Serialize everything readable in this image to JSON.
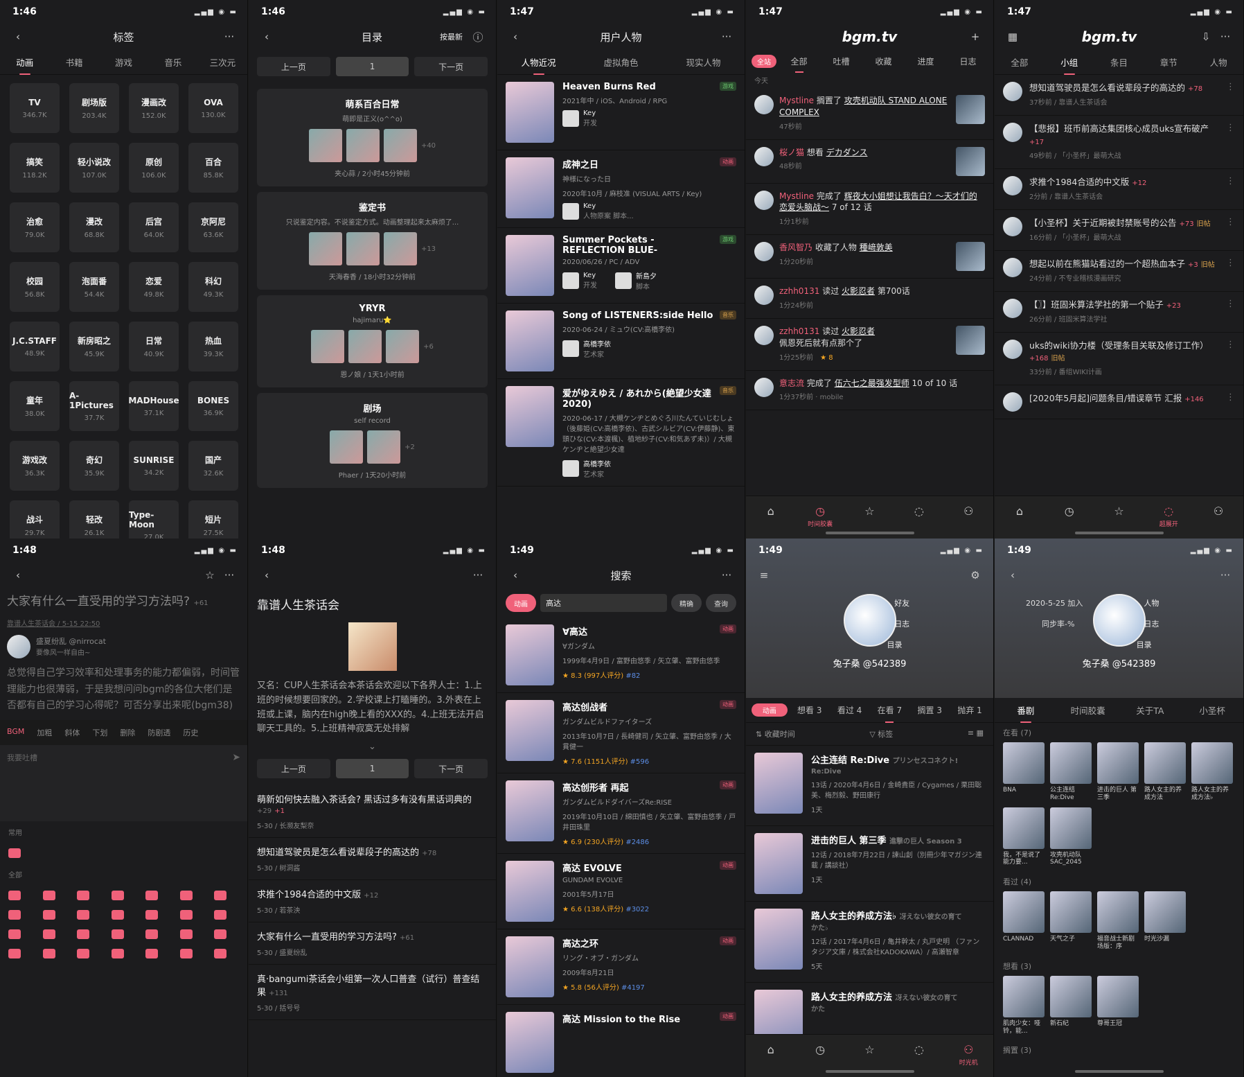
{
  "phones": {
    "p1": {
      "time": "1:46",
      "title": "标签",
      "tabs": [
        "动画",
        "书籍",
        "游戏",
        "音乐",
        "三次元"
      ],
      "tags": [
        {
          "n": "TV",
          "c": "346.7K"
        },
        {
          "n": "剧场版",
          "c": "203.4K"
        },
        {
          "n": "漫画改",
          "c": "152.0K"
        },
        {
          "n": "OVA",
          "c": "130.0K"
        },
        {
          "n": "搞笑",
          "c": "118.2K"
        },
        {
          "n": "轻小说改",
          "c": "107.0K"
        },
        {
          "n": "原创",
          "c": "106.0K"
        },
        {
          "n": "百合",
          "c": "85.8K"
        },
        {
          "n": "治愈",
          "c": "79.0K"
        },
        {
          "n": "漫改",
          "c": "68.8K"
        },
        {
          "n": "后宫",
          "c": "64.0K"
        },
        {
          "n": "京阿尼",
          "c": "63.6K"
        },
        {
          "n": "校园",
          "c": "56.8K"
        },
        {
          "n": "泡面番",
          "c": "54.4K"
        },
        {
          "n": "恋爱",
          "c": "49.8K"
        },
        {
          "n": "科幻",
          "c": "49.3K"
        },
        {
          "n": "J.C.STAFF",
          "c": "48.9K"
        },
        {
          "n": "新房昭之",
          "c": "45.9K"
        },
        {
          "n": "日常",
          "c": "40.9K"
        },
        {
          "n": "热血",
          "c": "39.3K"
        },
        {
          "n": "童年",
          "c": "38.0K"
        },
        {
          "n": "A-1Pictures",
          "c": "37.7K"
        },
        {
          "n": "MADHouse",
          "c": "37.1K"
        },
        {
          "n": "BONES",
          "c": "36.9K"
        },
        {
          "n": "游戏改",
          "c": "36.3K"
        },
        {
          "n": "奇幻",
          "c": "35.9K"
        },
        {
          "n": "SUNRISE",
          "c": "34.2K"
        },
        {
          "n": "国产",
          "c": "32.6K"
        },
        {
          "n": "战斗",
          "c": "29.7K"
        },
        {
          "n": "轻改",
          "c": "26.1K"
        },
        {
          "n": "Type-Moon",
          "c": "27.0K"
        },
        {
          "n": "短片",
          "c": "27.5K"
        }
      ]
    },
    "p2": {
      "time": "1:46",
      "title": "目录",
      "sort": "按最新",
      "prev": "上一页",
      "page": "1",
      "next": "下一页",
      "cards": [
        {
          "t": "萌系百合日常",
          "s": "萌即是正义(o^^o)",
          "more": "+40",
          "f": "夹心蒜 / 2小时45分钟前"
        },
        {
          "t": "鉴定书",
          "s": "只说鉴定内容。不说鉴定方式。动画整理起来太麻烦了...",
          "more": "+13",
          "f": "天海春香 / 18小时32分钟前"
        },
        {
          "t": "YRYR",
          "s": "hajimaru⭐",
          "more": "+6",
          "f": "恩ノ娘 / 1天1小时前"
        },
        {
          "t": "剧场",
          "s": "self record",
          "more": "+2",
          "f": "Phaer / 1天20小时前"
        }
      ]
    },
    "p3": {
      "time": "1:47",
      "title": "用户人物",
      "tabs": [
        "人物近况",
        "虚拟角色",
        "现实人物"
      ],
      "items": [
        {
          "t": "Heaven Burns Red",
          "d": "2021年中 / iOS、Android / RPG",
          "b": "游戏",
          "bc": "g",
          "cast": [
            {
              "n": "Key",
              "r": "开发"
            }
          ]
        },
        {
          "t": "成神之日",
          "d": "神様になった日",
          "d2": "2020年10月 / 麻枝准 (VISUAL ARTS / Key)",
          "b": "动画",
          "bc": "r",
          "cast": [
            {
              "n": "Key",
              "r": "人物原案 脚本..."
            }
          ]
        },
        {
          "t": "Summer Pockets -REFLECTION BLUE-",
          "d": "2020/06/26 / PC / ADV",
          "b": "游戏",
          "bc": "g",
          "cast": [
            {
              "n": "Key",
              "r": "开发"
            },
            {
              "n": "新島夕",
              "r": "脚本"
            }
          ]
        },
        {
          "t": "Song of LISTENERS:side Hello",
          "d": "2020-06-24 / ミュウ(CV:高橋李依)",
          "b": "音乐",
          "bc": "o",
          "cast": [
            {
              "n": "高橋李依",
              "r": "艺术家"
            }
          ]
        },
        {
          "t": "爱がゆえゆえ / あれから(絶望少女達2020)",
          "d": "2020-06-17 / 大槻ケンヂとめぐろ川たんていじむしょ（後藤姫(CV:高橋李依)、古武シルビア(CV:伊藤静)、東頭ひな(CV:本渡楓)、植地紗子(CV:和気あず未)）/ 大槻ケンヂと絶望少女達",
          "b": "音乐",
          "bc": "o",
          "cast": [
            {
              "n": "高橋李依",
              "r": "艺术家"
            }
          ]
        }
      ]
    },
    "p4": {
      "time": "1:47",
      "logo": "bgm.tv",
      "tabs": [
        "全站",
        "全部",
        "吐槽",
        "收藏",
        "进度",
        "日志"
      ],
      "today": "今天",
      "items": [
        {
          "u": "Mystline",
          "a": "搁置了",
          "o": "攻壳机动队 STAND ALONE COMPLEX",
          "m": "47秒前"
        },
        {
          "u": "桜ノ猫",
          "a": "想看",
          "o": "デカダンス",
          "m": "48秒前"
        },
        {
          "u": "Mystline",
          "a": "完成了",
          "o": "辉夜大小姐想让我告白？～天才们的恋爱头脑战～",
          "x": " 7 of 12 话",
          "m": "1分1秒前"
        },
        {
          "u": "香风智乃",
          "a": "收藏了人物",
          "o": "種﨑敦美",
          "m": "1分20秒前"
        },
        {
          "u": "zzhh0131",
          "a": "读过",
          "o": "火影忍者",
          "x": " 第700话",
          "m": "1分24秒前"
        },
        {
          "u": "zzhh0131",
          "a": "读过",
          "o": "火影忍者",
          "x": "",
          "c": "佩恩死后就有点那个了",
          "m": "1分25秒前",
          "r": "★ 8"
        },
        {
          "u": "意志流",
          "a": "完成了",
          "o": "伍六七之最强发型师",
          "x": " 10 of 10 话",
          "m": "1分37秒前 · mobile"
        }
      ],
      "nav": [
        "⌂",
        "时间胶囊",
        "☆",
        "💬",
        "👤"
      ]
    },
    "p5": {
      "time": "1:47",
      "logo": "bgm.tv",
      "tabs": [
        "全部",
        "小组",
        "条目",
        "章节",
        "人物"
      ],
      "sub": "全部",
      "items": [
        {
          "t": "想知道驾驶员是怎么看说辈段子的高达的",
          "n": "+78",
          "m": "37秒前 / 靠谱人生茶话会"
        },
        {
          "t": "【悲报】班币前高达集团核心成员uks宣布破产",
          "n": "+17",
          "m": "49秒前 / 「小圣杯」最萌大战"
        },
        {
          "t": "求推个1984合适的中文版",
          "n": "+12",
          "m": "2分前 / 靠谱人生茶话会"
        },
        {
          "t": "【小圣杯】关于近期被封禁账号的公告",
          "n": "+73",
          "o": "旧帖",
          "m": "16分前 / 「小圣杯」最萌大战"
        },
        {
          "t": "想起以前在熊猫站看过的一个超热血本子",
          "n": "+3",
          "o": "旧帖",
          "m": "24分前 / 不专业稽核漫画研究"
        },
        {
          "t": "【〗】班固米算法学社的第一个贴子",
          "n": "+23",
          "m": "26分前 / 班固米算法学社"
        },
        {
          "t": "uks的wiki协力楼（受理条目关联及修订工作）",
          "n": "+168",
          "o": "旧帖",
          "m": "33分前 / 番组WIKI计画"
        },
        {
          "t": "[2020年5月起]问题条目/错误章节 汇报",
          "n": "+146",
          "m": ""
        }
      ],
      "nav_label": "超展开"
    },
    "p6": {
      "time": "1:48",
      "title": "大家有什么一直受用的学习方法吗?",
      "count": "+61",
      "group": "靠谱人生茶话会 / 5-15 22:50",
      "user": "盛夏纷乱",
      "handle": "@nirrocat",
      "sign": "要像风一样自由~",
      "body": "总觉得自己学习效率和处理事务的能力都偏弱，时间管理能力也很薄弱，于是我想问问bgm的各位大佬们是否都有自己的学习心得呢？可否分享出来呢(bgm38)",
      "tools": [
        "BGM",
        "加粗",
        "斜体",
        "下划",
        "删除",
        "防剧透",
        "历史"
      ],
      "placeholder": "我要吐槽",
      "common": "常用",
      "all": "全部"
    },
    "p7": {
      "time": "1:48",
      "title": "靠谱人生茶话会",
      "desc": "又名：CUP人生茶话会本茶话会欢迎以下各界人士：1.上班的时候想要回家的。2.学校课上打瞌睡的。3.外表在上班或上课，脑内在high晚上看的XXX的。4.上班无法开启聊天工具的。5.上班精神寂寞无处排解",
      "prev": "上一页",
      "page": "1",
      "next": "下一页",
      "topics": [
        {
          "t": "萌新如何快去融入茶话会? 黑话过多有没有黑话词典的",
          "n": "+29",
          "x": "+1",
          "m": "5-30 / 长濒友梨奈"
        },
        {
          "t": "想知道驾驶员是怎么看说辈段子的高达的",
          "n": "+78",
          "m": "5-30 / 树洞酱"
        },
        {
          "t": "求推个1984合适的中文版",
          "n": "+12",
          "m": "5-30 / 若茶泱"
        },
        {
          "t": "大家有什么一直受用的学习方法吗?",
          "n": "+61",
          "m": "5-30 / 盛夏纷乱"
        },
        {
          "t": "真·bangumi茶话会小组第一次人口普查（试行）普查结果",
          "n": "+131",
          "m": "5-30 / 括号号"
        }
      ]
    },
    "p8": {
      "time": "1:49",
      "title": "搜索",
      "type": "动画",
      "query": "高达",
      "mode": "精确",
      "go": "查询",
      "items": [
        {
          "t": "∀高达",
          "j": "∀ガンダム",
          "d": "1999年4月9日 / 富野由悠季 / 矢立肇、富野由悠季",
          "s": "★ 8.3 (997人评分)",
          "r": "#82"
        },
        {
          "t": "高达创战者",
          "j": "ガンダムビルドファイターズ",
          "d": "2013年10月7日 / 長崎健司 / 矢立肇、富野由悠季 / 大貫健一",
          "s": "★ 7.6 (1151人评分)",
          "r": "#596"
        },
        {
          "t": "高达创形者 再起",
          "j": "ガンダムビルドダイバーズRe:RISE",
          "d": "2019年10月10日 / 綿田慎也 / 矢立肇、富野由悠季 / 戸井田珠里",
          "s": "★ 6.9 (230人评分)",
          "r": "#2486"
        },
        {
          "t": "高达 EVOLVE",
          "j": "GUNDAM EVOLVE",
          "d": "2001年5月17日",
          "s": "★ 6.6 (138人评分)",
          "r": "#3022"
        },
        {
          "t": "高达之环",
          "j": "リング・オブ・ガンダム",
          "d": "2009年8月21日",
          "s": "★ 5.8 (56人评分)",
          "r": "#4197"
        },
        {
          "t": "高达 Mission to the Rise",
          "j": "",
          "d": "",
          "s": "",
          "r": ""
        }
      ],
      "badge": "动画"
    },
    "p9": {
      "time": "1:49",
      "name": "兔子桑 @542389",
      "links": [
        "好友",
        "日志",
        "目录"
      ],
      "tabs": [
        {
          "l": "动画",
          "p": true
        },
        {
          "l": "想看 3"
        },
        {
          "l": "看过 4"
        },
        {
          "l": "在看 7",
          "on": true
        },
        {
          "l": "搁置 3"
        },
        {
          "l": "抛弃 1"
        }
      ],
      "sort": "收藏时间",
      "tag": "标签",
      "items": [
        {
          "t": "公主连结 Re:Dive",
          "j": "プリンセスコネクト! Re:Dive",
          "d": "13话 / 2020年4月6日 / 金崎貴臣 / Cygames / 栗田聡美、梅烈毅、野田康行",
          "m": "1天"
        },
        {
          "t": "进击的巨人 第三季",
          "j": "進撃の巨人 Season 3",
          "d": "12话 / 2018年7月22日 / 諫山創（別冊少年マガジン連載 / 講談社）",
          "m": "1天"
        },
        {
          "t": "路人女主的养成方法♭",
          "j": "冴えない彼女の育てかた♭",
          "d": "12话 / 2017年4月6日 / 亀井幹太 / 丸戸史明 （ファンタジア文庫 / 株式会社KADOKAWA）/ 高瀬智章",
          "m": "5天"
        },
        {
          "t": "路人女主的养成方法",
          "j": "冴えない彼女の育てかた",
          "d": "",
          "m": ""
        }
      ],
      "nav_label": "时光机"
    },
    "p10": {
      "time": "1:49",
      "joined": "2020-5-25 加入",
      "sync": "同步率-%",
      "name": "兔子桑 @542389",
      "links": [
        "人物",
        "日志",
        "目录"
      ],
      "tabs": [
        "番剧",
        "时间胶囊",
        "关于TA",
        "小圣杯"
      ],
      "sections": [
        {
          "h": "在看 (7)",
          "items": [
            "BNA",
            "公主连结 Re:Dive",
            "进击的巨人 第三季",
            "路人女主的养成方法",
            "路人女主的养成方法♭",
            "我，不是说了能力要...",
            "攻壳机动队 SAC_2045"
          ]
        },
        {
          "h": "看过 (4)",
          "items": [
            "CLANNAD",
            "天气之子",
            "福音战士新剧场版：序",
            "时光沙漏"
          ]
        },
        {
          "h": "想看 (3)",
          "items": [
            "肌肉少女：哑铃，能...",
            "新石纪",
            "尊哥王冠"
          ]
        },
        {
          "h": "搁置 (3)",
          "items": []
        }
      ]
    }
  }
}
